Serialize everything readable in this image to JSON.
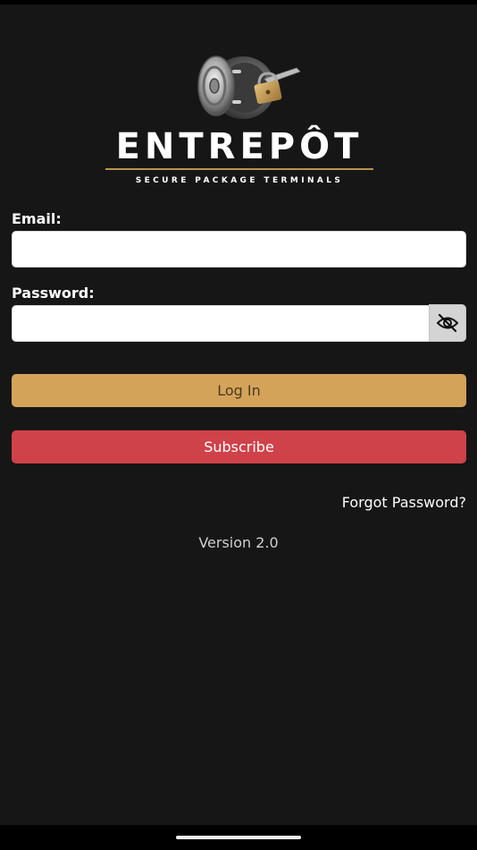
{
  "brand": {
    "name": "ENTREPÔT",
    "tagline": "SECURE PACKAGE TERMINALS",
    "accent_color": "#b8924f",
    "logo_icon": "vault-safe-with-padlock-icon"
  },
  "form": {
    "email_label": "Email:",
    "email_value": "",
    "email_placeholder": "",
    "password_label": "Password:",
    "password_value": "",
    "password_placeholder": "",
    "toggle_icon": "eye-slash-icon"
  },
  "actions": {
    "login_label": "Log In",
    "login_color": "#d4a35a",
    "subscribe_label": "Subscribe",
    "subscribe_color": "#cf424a",
    "forgot_password_label": "Forgot Password?"
  },
  "footer": {
    "version": "Version 2.0"
  },
  "theme": {
    "background": "#161616"
  }
}
